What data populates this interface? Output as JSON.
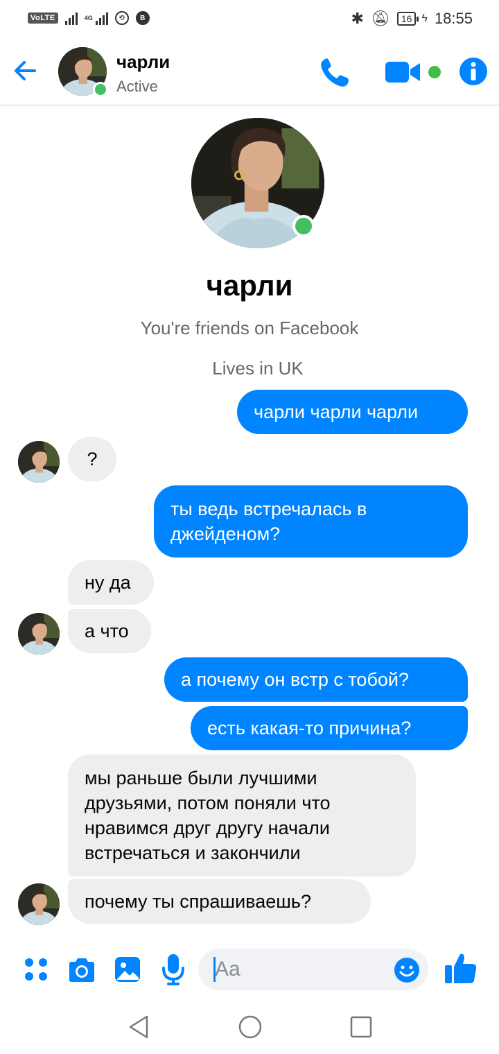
{
  "status_bar": {
    "volte": "VoLTE",
    "network": "4G",
    "battery": "16",
    "time": "18:55"
  },
  "header": {
    "name": "чарли",
    "status": "Active"
  },
  "profile": {
    "name": "чарли",
    "friends_text": "You're friends on Facebook",
    "lives_text": "Lives in UK"
  },
  "messages": [
    {
      "from": "me",
      "text": "чарли чарли чарли"
    },
    {
      "from": "them",
      "text": "?"
    },
    {
      "from": "me",
      "text": "ты ведь встречалась в джейденом?"
    },
    {
      "from": "them",
      "text": "ну да"
    },
    {
      "from": "them",
      "text": "а что"
    },
    {
      "from": "me",
      "text": "а почему он встр с тобой?"
    },
    {
      "from": "me",
      "text": "есть какая-то причина?"
    },
    {
      "from": "them",
      "text": "мы раньше были лучшими друзьями, потом поняли что нравимся друг другу начали встречаться и закончили"
    },
    {
      "from": "them",
      "text": "почему ты спрашиваешь?"
    }
  ],
  "composer": {
    "placeholder": "Aa"
  },
  "colors": {
    "accent": "#0084ff",
    "online": "#45bd62",
    "incoming_bubble": "#eeeef0"
  },
  "icons": {
    "header": [
      "back-arrow-icon",
      "phone-icon",
      "video-camera-icon",
      "info-icon"
    ],
    "composer": [
      "apps-grid-icon",
      "camera-icon",
      "image-icon",
      "microphone-icon",
      "smile-icon",
      "thumbs-up-icon"
    ],
    "nav": [
      "nav-back-icon",
      "nav-home-icon",
      "nav-recents-icon"
    ]
  }
}
